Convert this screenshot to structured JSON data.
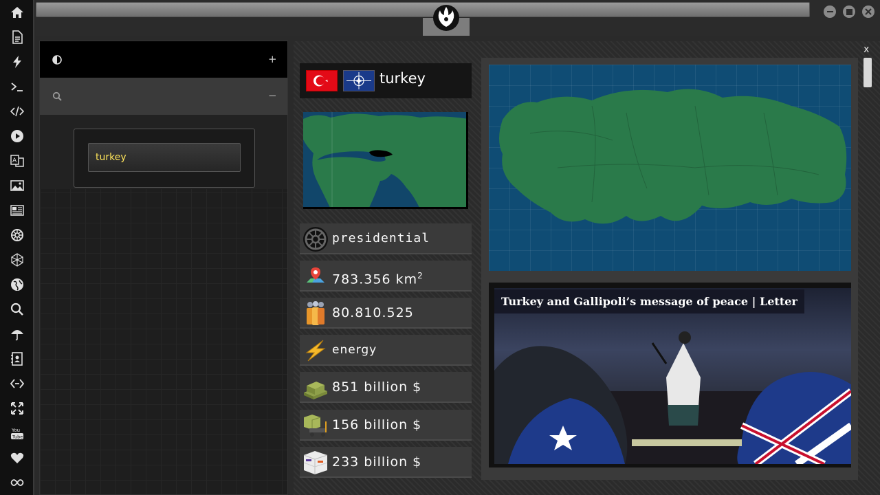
{
  "sidebar": {
    "items": [
      {
        "icon": "home-icon"
      },
      {
        "icon": "document-icon"
      },
      {
        "icon": "lightning-icon"
      },
      {
        "icon": "terminal-icon"
      },
      {
        "icon": "code-icon"
      },
      {
        "icon": "play-icon"
      },
      {
        "icon": "translate-icon"
      },
      {
        "icon": "image-icon"
      },
      {
        "icon": "newspaper-icon"
      },
      {
        "icon": "empire-icon"
      },
      {
        "icon": "polyhedron-icon"
      },
      {
        "icon": "globe-icon"
      },
      {
        "icon": "search-icon"
      },
      {
        "icon": "umbrella-icon"
      },
      {
        "icon": "contacts-icon"
      },
      {
        "icon": "link-icon"
      },
      {
        "icon": "expand-icon"
      },
      {
        "icon": "youtube-icon"
      },
      {
        "icon": "heart-icon"
      },
      {
        "icon": "infinity-icon"
      }
    ]
  },
  "left_panel": {
    "top_row_add": "+",
    "second_row_collapse": "−",
    "search_value": "turkey"
  },
  "main": {
    "close_label": "x",
    "country": "turkey",
    "government": "presidential",
    "area_value": "783.356 km",
    "area_unit_sup": "2",
    "population": "80.810.525",
    "sector": "energy",
    "gdp": "851 billion $",
    "imports": "156 billion $",
    "exports": "233 billion $",
    "news_title": "Turkey and Gallipoli’s message of peace | Letter"
  },
  "colors": {
    "land": "#2a7a4a",
    "sea": "#0f4c74",
    "search_text": "#ffe55a",
    "flag_red": "#e30a17",
    "nato_blue": "#1a3a8a"
  }
}
